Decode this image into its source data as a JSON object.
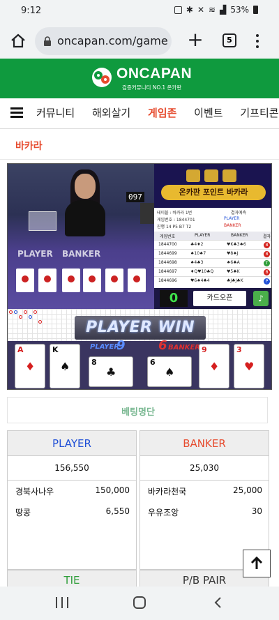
{
  "statusbar": {
    "time": "9:12",
    "battery": "53%"
  },
  "browser": {
    "url": "oncapan.com/game",
    "tab_count": "5"
  },
  "site": {
    "logo_name": "ONCAPAN",
    "logo_sub": "검증커뮤니티 NO.1 온카판"
  },
  "nav": {
    "items": [
      {
        "label": "커뮤니티",
        "active": false
      },
      {
        "label": "해외살기",
        "active": false
      },
      {
        "label": "게임존",
        "active": true
      },
      {
        "label": "이벤트",
        "active": false
      },
      {
        "label": "기프티콘",
        "active": false
      }
    ]
  },
  "page": {
    "subtitle": "바카라"
  },
  "game": {
    "video": {
      "display": "097",
      "player_label": "PLAYER",
      "banker_label": "BANKER"
    },
    "info": {
      "banner": "온카판 포인트 바카라",
      "table_line": "테이블 : 바카라 1번",
      "round_line": "게임번호 : 1844701",
      "progress_line": "진행 14  P5  B7  T2",
      "predict_title": "결과예측",
      "predict_player": "PLAYER",
      "predict_banker": "BANKER",
      "history_headers": [
        "게임번호",
        "PLAYER",
        "BANKER",
        "결과"
      ],
      "history": [
        {
          "round": "1844700",
          "player": "♣4♦2",
          "banker": "♥K♣3♠6",
          "result": "B",
          "color": "#d4241e"
        },
        {
          "round": "1844699",
          "player": "♠10♠7",
          "banker": "♥8♠J",
          "result": "B",
          "color": "#d4241e"
        },
        {
          "round": "1844698",
          "player": "♠4♣3",
          "banker": "♠6♣A",
          "result": "T",
          "color": "#2f9e3a"
        },
        {
          "round": "1844697",
          "player": "♦Q♥10♣Q",
          "banker": "♥5♣K",
          "result": "B",
          "color": "#d4241e"
        },
        {
          "round": "1844696",
          "player": "♥6♠4♣4",
          "banker": "♣J♣J♣K",
          "result": "P",
          "color": "#1f4fd6"
        }
      ],
      "counter": "0",
      "open_button": "카드오픈"
    },
    "win_text": "PLAYER WIN",
    "result": {
      "player_label": "PLAYER",
      "player_score": "9",
      "banker_label": "BANKER",
      "banker_score": "6"
    },
    "cards": [
      {
        "rank": "A",
        "suit": "♦",
        "color": "red"
      },
      {
        "rank": "K",
        "suit": "♠",
        "color": "blk"
      },
      {
        "rank": "8",
        "suit": "♣",
        "color": "blk"
      },
      {
        "rank": "6",
        "suit": "♠",
        "color": "blk"
      },
      {
        "rank": "9",
        "suit": "♦",
        "color": "red"
      },
      {
        "rank": "3",
        "suit": "♥",
        "color": "red"
      }
    ]
  },
  "betting": {
    "title": "베팅명단",
    "player": {
      "label": "PLAYER",
      "color": "#1f4fd6",
      "total": "156,550",
      "rows": [
        {
          "name": "경북사나우",
          "amount": "150,000"
        },
        {
          "name": "땅콩",
          "amount": "6,550"
        }
      ]
    },
    "banker": {
      "label": "BANKER",
      "color": "#e64b2e",
      "total": "25,030",
      "rows": [
        {
          "name": "바카라천국",
          "amount": "25,000"
        },
        {
          "name": "우유조앙",
          "amount": "30"
        }
      ]
    },
    "tie_label": "TIE",
    "pb_pair_label": "P/B PAIR"
  },
  "colors": {
    "brand_green": "#0f9a3e",
    "active_nav": "#e64b2e"
  }
}
